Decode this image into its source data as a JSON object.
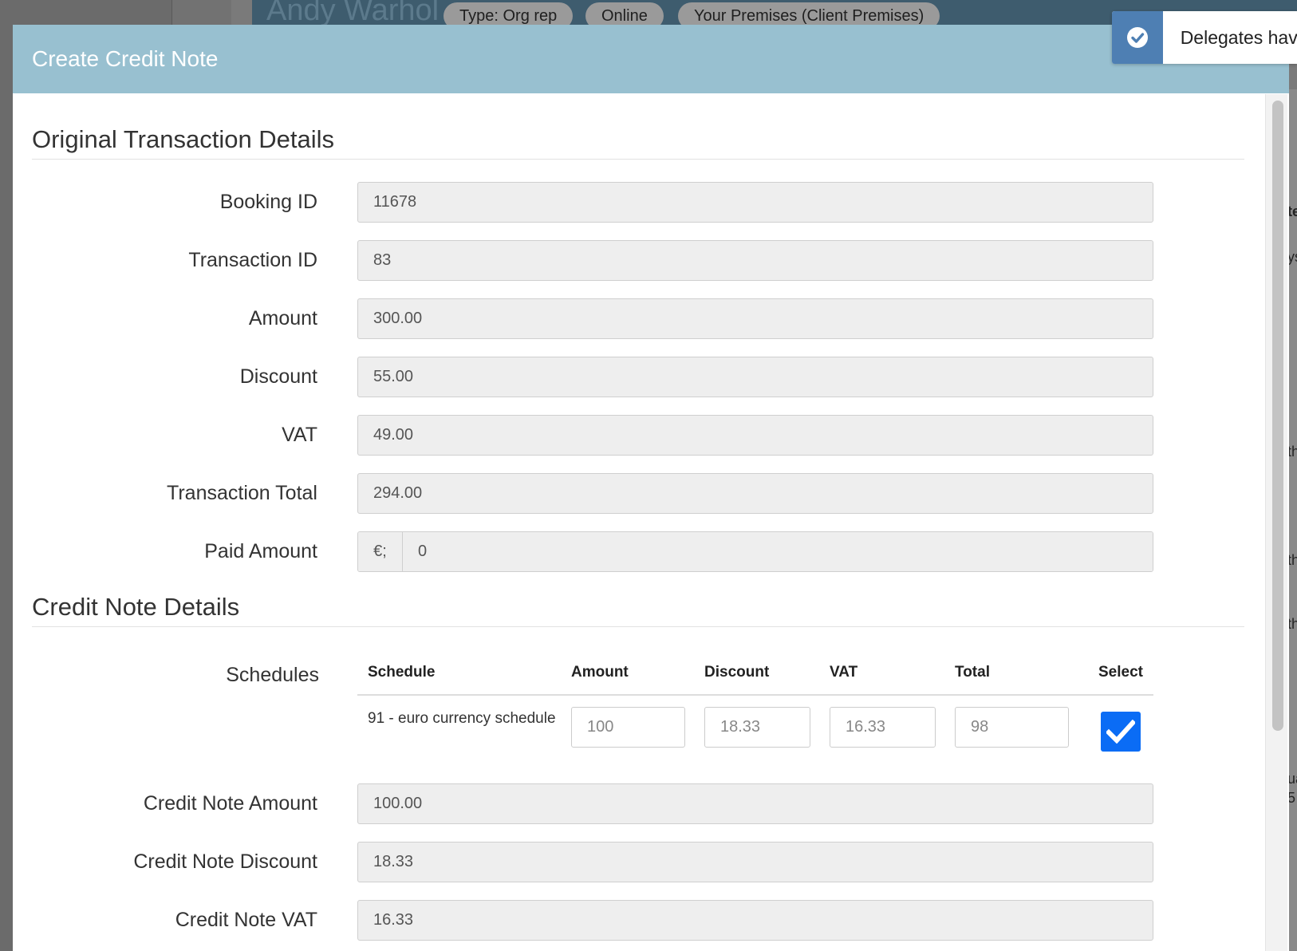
{
  "background": {
    "person_name": "Andy Warhol",
    "chips": [
      "Type: Org rep",
      "Online",
      "Your Premises (Client Premises)"
    ],
    "right_fragments": [
      "te",
      "ys",
      "th",
      "th",
      "th",
      "ua",
      "5"
    ]
  },
  "toast": {
    "message": "Delegates hav",
    "icon": "check-circle-icon"
  },
  "modal": {
    "title": "Create Credit Note",
    "original_section_title": "Original Transaction Details",
    "original_fields": [
      {
        "label": "Booking ID",
        "value": "11678"
      },
      {
        "label": "Transaction ID",
        "value": "83"
      },
      {
        "label": "Amount",
        "value": "300.00"
      },
      {
        "label": "Discount",
        "value": "55.00"
      },
      {
        "label": "VAT",
        "value": "49.00"
      },
      {
        "label": "Transaction Total",
        "value": "294.00"
      }
    ],
    "paid_amount": {
      "label": "Paid Amount",
      "currency": "€;",
      "value": "0"
    },
    "credit_section_title": "Credit Note Details",
    "schedules": {
      "label": "Schedules",
      "headers": [
        "Schedule",
        "Amount",
        "Discount",
        "VAT",
        "Total",
        "Select"
      ],
      "rows": [
        {
          "schedule": "91 - euro currency schedule",
          "amount": "100",
          "discount": "18.33",
          "vat": "16.33",
          "total": "98",
          "selected": true
        }
      ]
    },
    "credit_fields": [
      {
        "label": "Credit Note Amount",
        "value": "100.00"
      },
      {
        "label": "Credit Note Discount",
        "value": "18.33"
      },
      {
        "label": "Credit Note VAT",
        "value": "16.33"
      }
    ]
  },
  "colors": {
    "modal_header": "#98c0d0",
    "checkbox": "#0a6cf5",
    "toast_icon": "#4e7fb3"
  }
}
